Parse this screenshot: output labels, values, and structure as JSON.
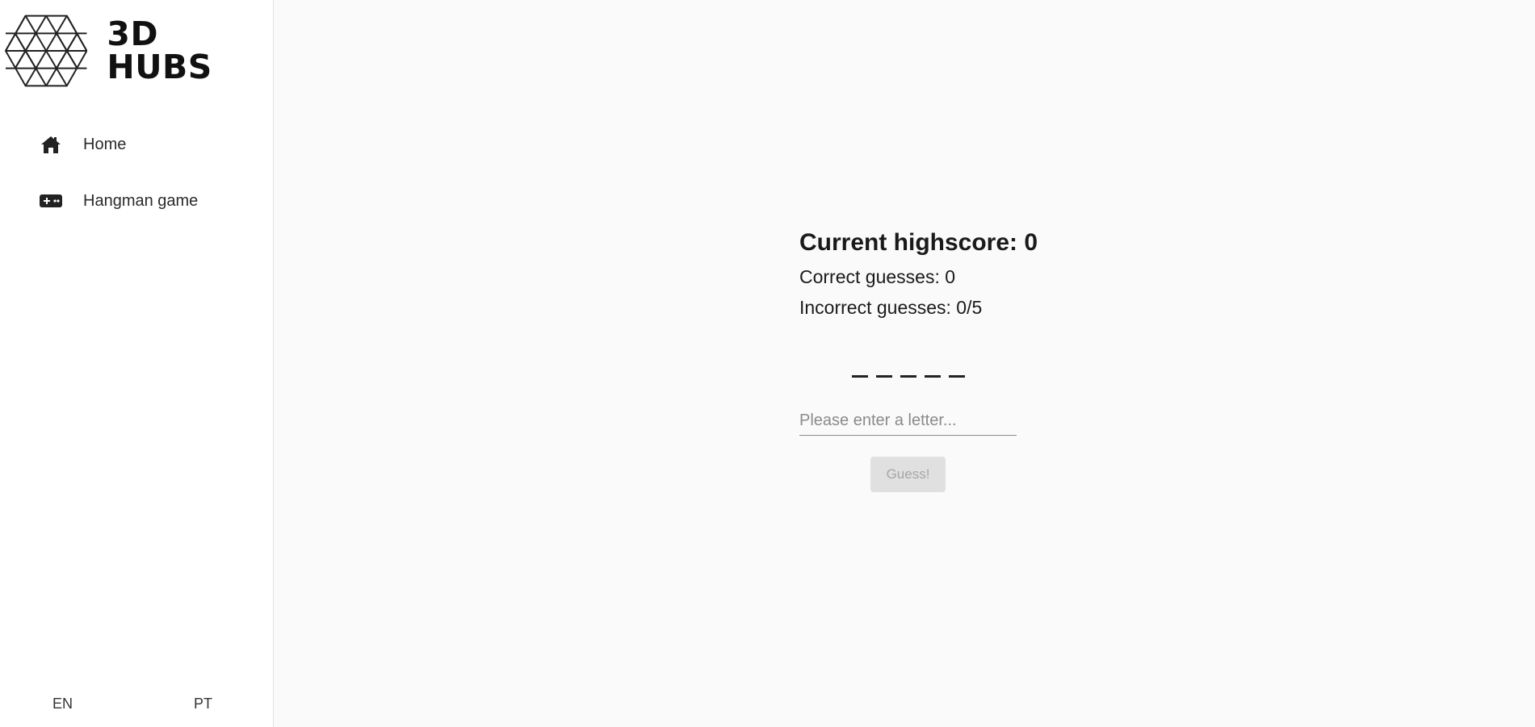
{
  "brand": {
    "name": "3D HUBS",
    "logo_icon": "hexagon-grid-logo-icon"
  },
  "sidebar": {
    "items": [
      {
        "label": "Home",
        "icon": "home-icon"
      },
      {
        "label": "Hangman game",
        "icon": "gamepad-icon"
      }
    ],
    "languages": [
      "EN",
      "PT"
    ]
  },
  "game": {
    "highscore": "Current highscore: 0",
    "correct": "Correct guesses: 0",
    "incorrect": "Incorrect guesses: 0/5",
    "word_slots": 5,
    "input_placeholder": "Please enter a letter...",
    "input_value": "",
    "guess_label": "Guess!",
    "guess_disabled": true
  },
  "colors": {
    "sidebar_bg": "#ffffff",
    "main_bg": "#fafafa",
    "text": "#1a1a1a",
    "button_disabled_bg": "#e0e0e0",
    "button_disabled_text": "#a6a6a6"
  }
}
